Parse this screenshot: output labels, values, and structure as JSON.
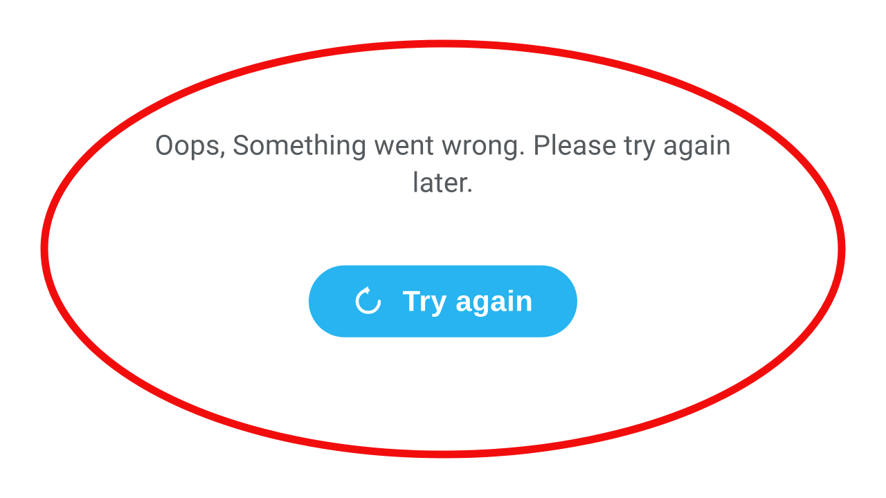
{
  "error": {
    "message": "Oops, Something went wrong. Please try again later."
  },
  "actions": {
    "retry_label": "Try again"
  },
  "colors": {
    "accent": "#27b4f0",
    "highlight": "#f20d0d"
  }
}
